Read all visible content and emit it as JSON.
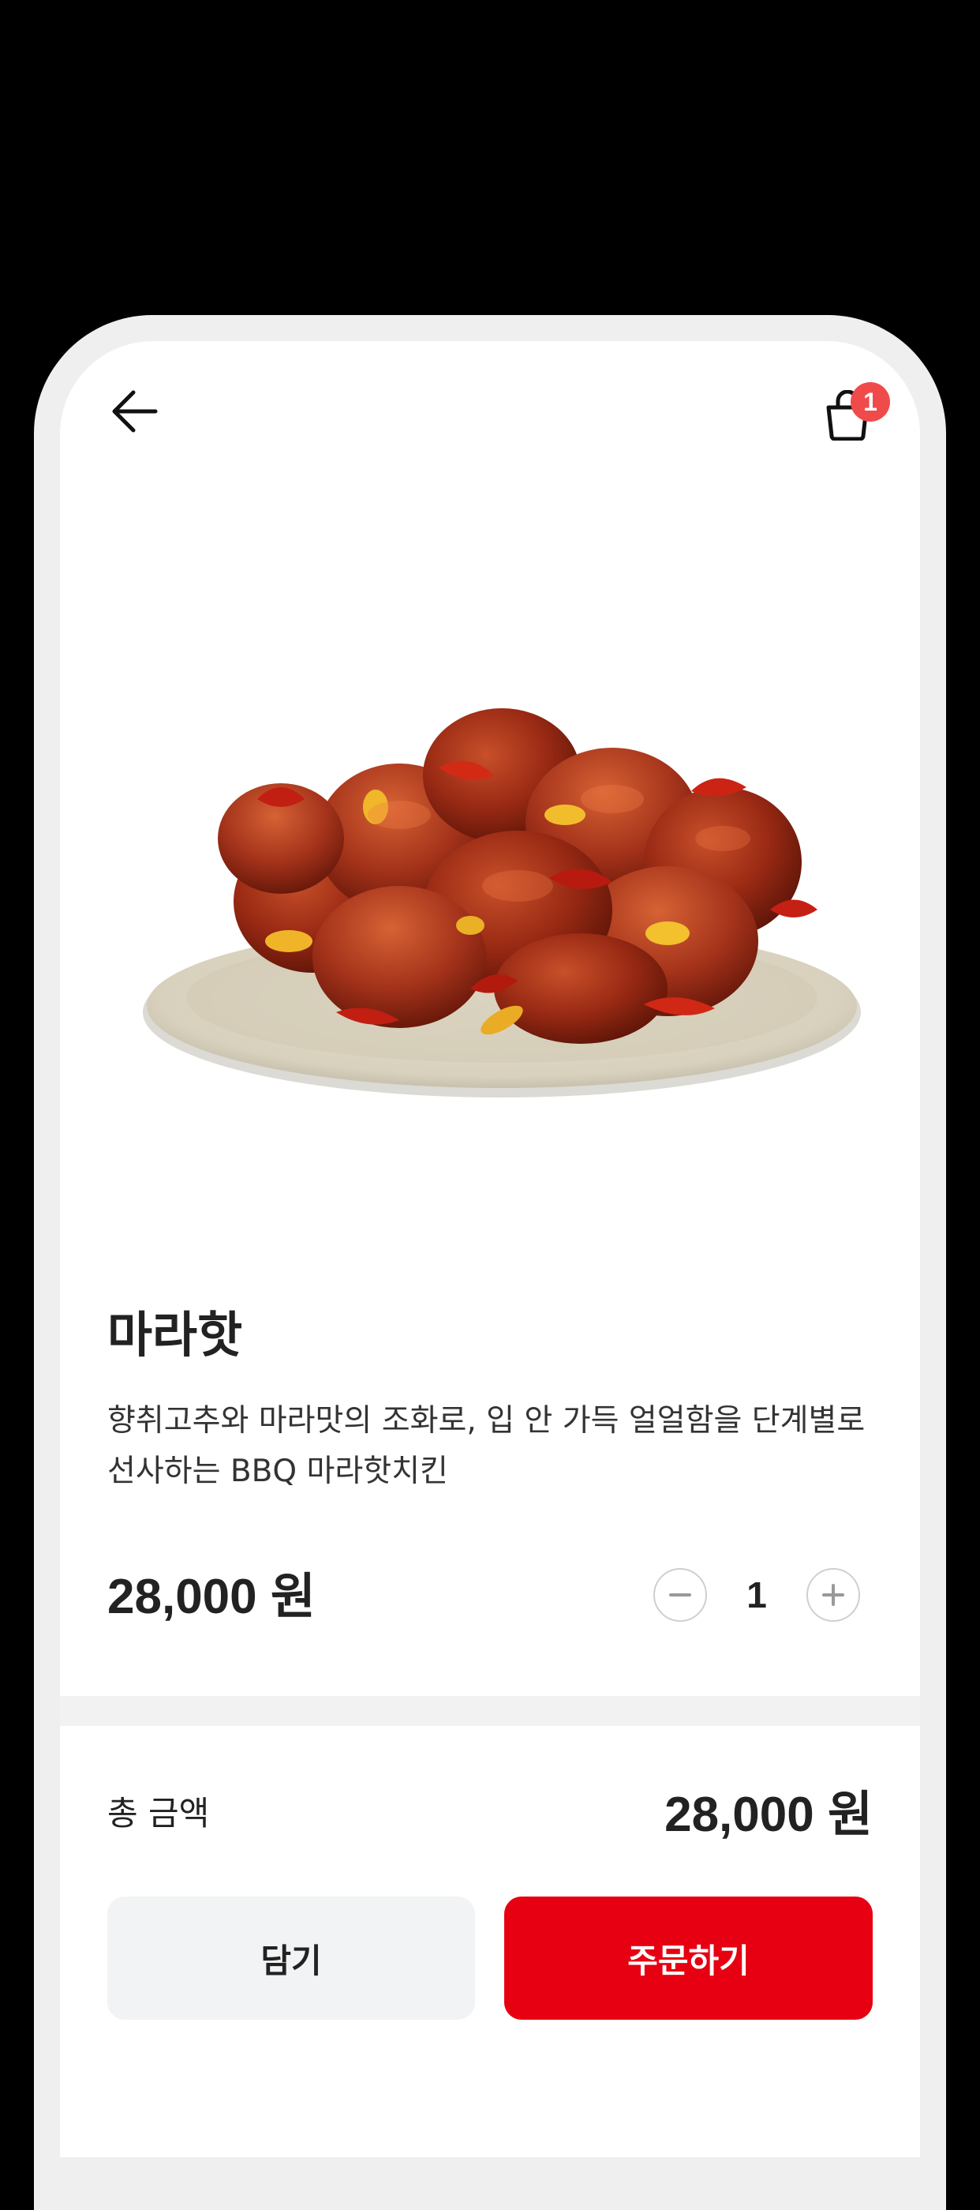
{
  "header": {
    "back_icon": "arrow-left-icon",
    "cart_icon": "shopping-bag-icon",
    "cart_badge_count": "1",
    "badge_color": "#f04a4a"
  },
  "product": {
    "image_alt": "마라핫",
    "name": "마라핫",
    "description": "향취고추와 마라맛의 조화로, 입 안 가득 얼얼함을 단계별로 선사하는 BBQ 마라핫치킨",
    "price": "28,000 원"
  },
  "quantity": {
    "value": "1",
    "minus_icon": "minus-icon",
    "plus_icon": "plus-icon"
  },
  "summary": {
    "total_label": "총 금액",
    "total_price": "28,000 원"
  },
  "actions": {
    "cart_label": "담기",
    "order_label": "주문하기",
    "order_color": "#e60012"
  }
}
